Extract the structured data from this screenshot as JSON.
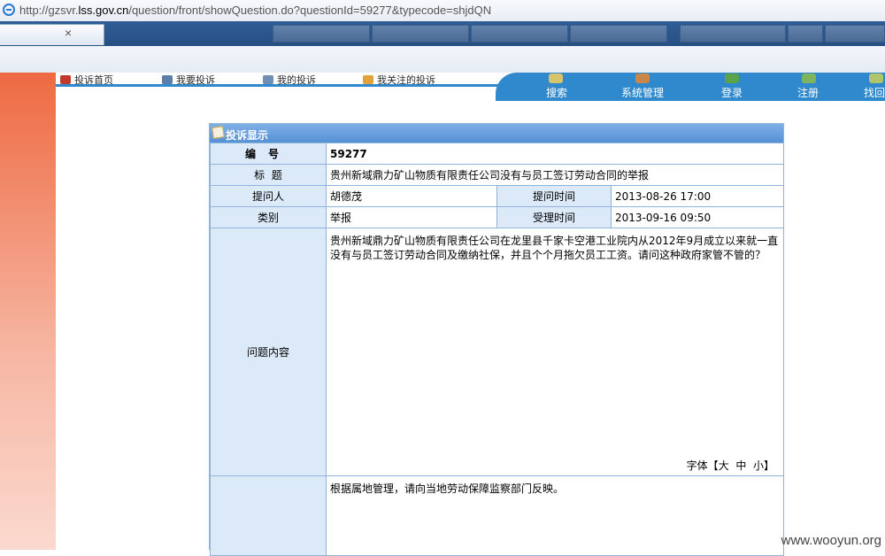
{
  "browser": {
    "url_prefix": "http://gzsvr.",
    "url_domain": "lss.gov.cn",
    "url_rest": "/question/front/showQuestion.do?questionId=59277&typecode=shjdQN",
    "tab_close": "×"
  },
  "nav": {
    "left": [
      "投诉首页",
      "我要投诉",
      "我的投诉",
      "我关注的投诉"
    ],
    "right": [
      "搜索",
      "系统管理",
      "登录",
      "注册",
      "找回"
    ]
  },
  "panel": {
    "title": "投诉显示",
    "id_label": "编号",
    "id_value": "59277",
    "title_label": "标  题",
    "title_value": "贵州新域鼎力矿山物质有限责任公司没有与员工签订劳动合同的举报",
    "asker_label": "提问人",
    "asker_value": "胡德茂",
    "ask_time_label": "提问时间",
    "ask_time_value": "2013-08-26 17:00",
    "type_label": "类别",
    "type_value": "举报",
    "accept_time_label": "受理时间",
    "accept_time_value": "2013-09-16 09:50",
    "content_label": "问题内容",
    "content_value": "贵州新域鼎力矿山物质有限责任公司在龙里县千家卡空港工业院内从2012年9月成立以来就一直没有与员工签订劳动合同及缴纳社保，并且个个月拖欠员工工资。请问这种政府家管不管的？",
    "font_label": "字体【",
    "font_large": "大",
    "font_medium": "中",
    "font_small": "小",
    "font_close": "】",
    "reply_value": "根据属地管理，请向当地劳动保障监察部门反映。"
  },
  "watermark": "www.wooyun.org"
}
